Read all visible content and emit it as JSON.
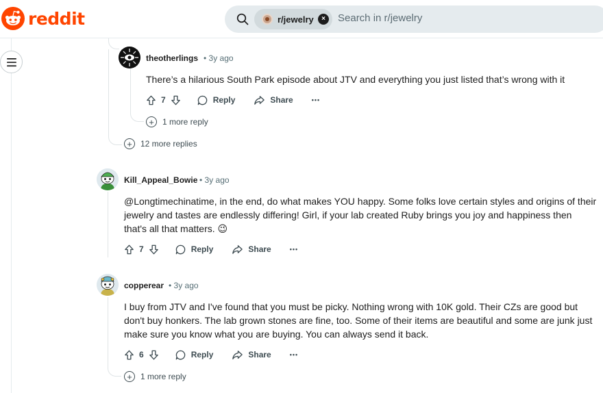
{
  "header": {
    "logo_text": "reddit",
    "brand_color": "#ff4500",
    "search": {
      "chip_label": "r/jewelry",
      "chip_close": "×",
      "placeholder": "Search in r/jewelry"
    }
  },
  "comments": [
    {
      "author": "theotherlings",
      "time": "• 3y ago",
      "body": "There’s a hilarious South Park episode about JTV and everything you just listed that’s wrong with it",
      "votes": "7",
      "reply_label": "Reply",
      "share_label": "Share",
      "more_label": "•••",
      "more_replies": "1 more reply"
    },
    {
      "author": "Kill_Appeal_Bowie",
      "time": "• 3y ago",
      "body": "@Longtimechinatime, in the end, do what makes YOU happy. Some folks love certain styles and origins of their jewelry and tastes are endlessly differing! Girl, if your lab created Ruby brings you joy and happiness then that's all that matters. 😉",
      "votes": "7",
      "reply_label": "Reply",
      "share_label": "Share",
      "more_label": "•••"
    },
    {
      "author": "copperear",
      "time": "• 3y ago",
      "body": "I buy from JTV and I've found that you must be picky. Nothing wrong with 10K gold. Their CZs are good but don't buy honkers. The lab grown stones are fine, too. Some of their items are beautiful and some are junk just make sure you know what you are buying. You can always send it back.",
      "votes": "6",
      "reply_label": "Reply",
      "share_label": "Share",
      "more_label": "•••",
      "more_replies": "1 more reply"
    }
  ],
  "thread": {
    "more_replies": "12 more replies"
  }
}
